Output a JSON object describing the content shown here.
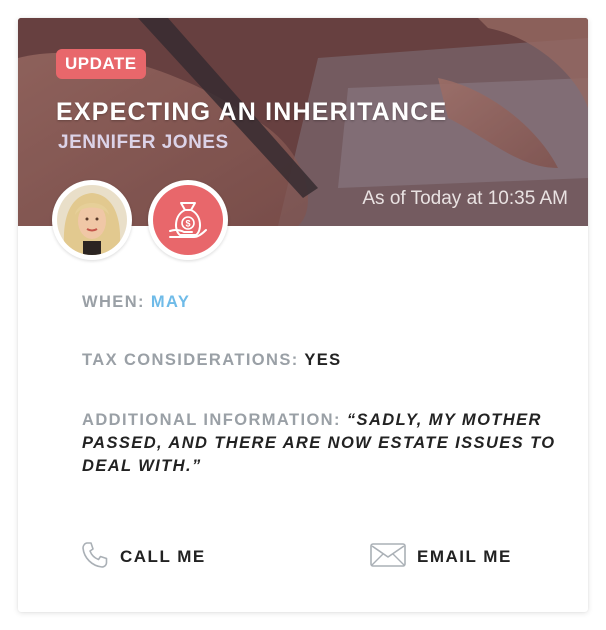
{
  "card": {
    "badge": "UPDATE",
    "title": "EXPECTING AN INHERITANCE",
    "client_name": "JENNIFER JONES",
    "timestamp": "As of Today at 10:35 AM",
    "category_icon": "money-bag-icon",
    "avatar": "client-photo"
  },
  "details": {
    "when_label": "WHEN:",
    "when_value": "MAY",
    "tax_label": "TAX CONSIDERATIONS:",
    "tax_value": "YES",
    "info_label": "ADDITIONAL INFORMATION:",
    "info_value": "“SADLY, MY MOTHER PASSED, AND THERE ARE NOW ESTATE ISSUES TO DEAL WITH.”"
  },
  "actions": {
    "call_label": "CALL ME",
    "call_icon": "phone-icon",
    "email_label": "EMAIL ME",
    "email_icon": "envelope-icon"
  },
  "colors": {
    "accent": "#e8676b",
    "highlight": "#6fbbe8",
    "label": "#9aa0a6",
    "text": "#222222"
  }
}
